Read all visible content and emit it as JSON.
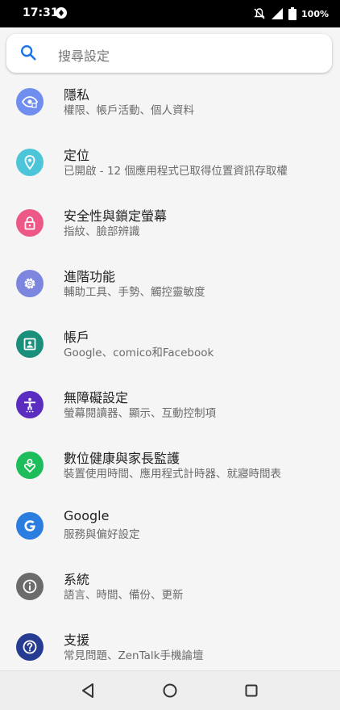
{
  "status_bar": {
    "time": "17:31",
    "battery": "100%"
  },
  "search": {
    "placeholder": "搜尋設定"
  },
  "settings": [
    {
      "title": "隱私",
      "subtitle": "權限、帳戶活動、個人資料",
      "icon": "privacy-eye-icon",
      "color": "#6f8ef0"
    },
    {
      "title": "定位",
      "subtitle": "已開啟 - 12 個應用程式已取得位置資訊存取權",
      "icon": "location-pin-icon",
      "color": "#4dc5d9"
    },
    {
      "title": "安全性與鎖定螢幕",
      "subtitle": "指紋、臉部辨識",
      "icon": "lock-icon",
      "color": "#ee5887"
    },
    {
      "title": "進階功能",
      "subtitle": "輔助工具、手勢、觸控靈敏度",
      "icon": "gear-icon",
      "color": "#7d86df"
    },
    {
      "title": "帳戶",
      "subtitle": "Google、comico和Facebook",
      "icon": "account-icon",
      "color": "#198f7c"
    },
    {
      "title": "無障礙設定",
      "subtitle": "螢幕閱讀器、顯示、互動控制項",
      "icon": "accessibility-icon",
      "color": "#5a2dc0"
    },
    {
      "title": "數位健康與家長監護",
      "subtitle": "裝置使用時間、應用程式計時器、就寢時間表",
      "icon": "wellbeing-icon",
      "color": "#1dbd5b"
    },
    {
      "title": "Google",
      "subtitle": "服務與偏好設定",
      "icon": "google-icon",
      "color": "#2c7de0"
    },
    {
      "title": "系統",
      "subtitle": "語言、時間、備份、更新",
      "icon": "info-icon",
      "color": "#6b6b6b"
    },
    {
      "title": "支援",
      "subtitle": "常見問題、ZenTalk手機論壇",
      "icon": "help-icon",
      "color": "#253c92"
    }
  ],
  "colors": {
    "accent": "#1a73e8",
    "background": "#f5f5f5"
  }
}
